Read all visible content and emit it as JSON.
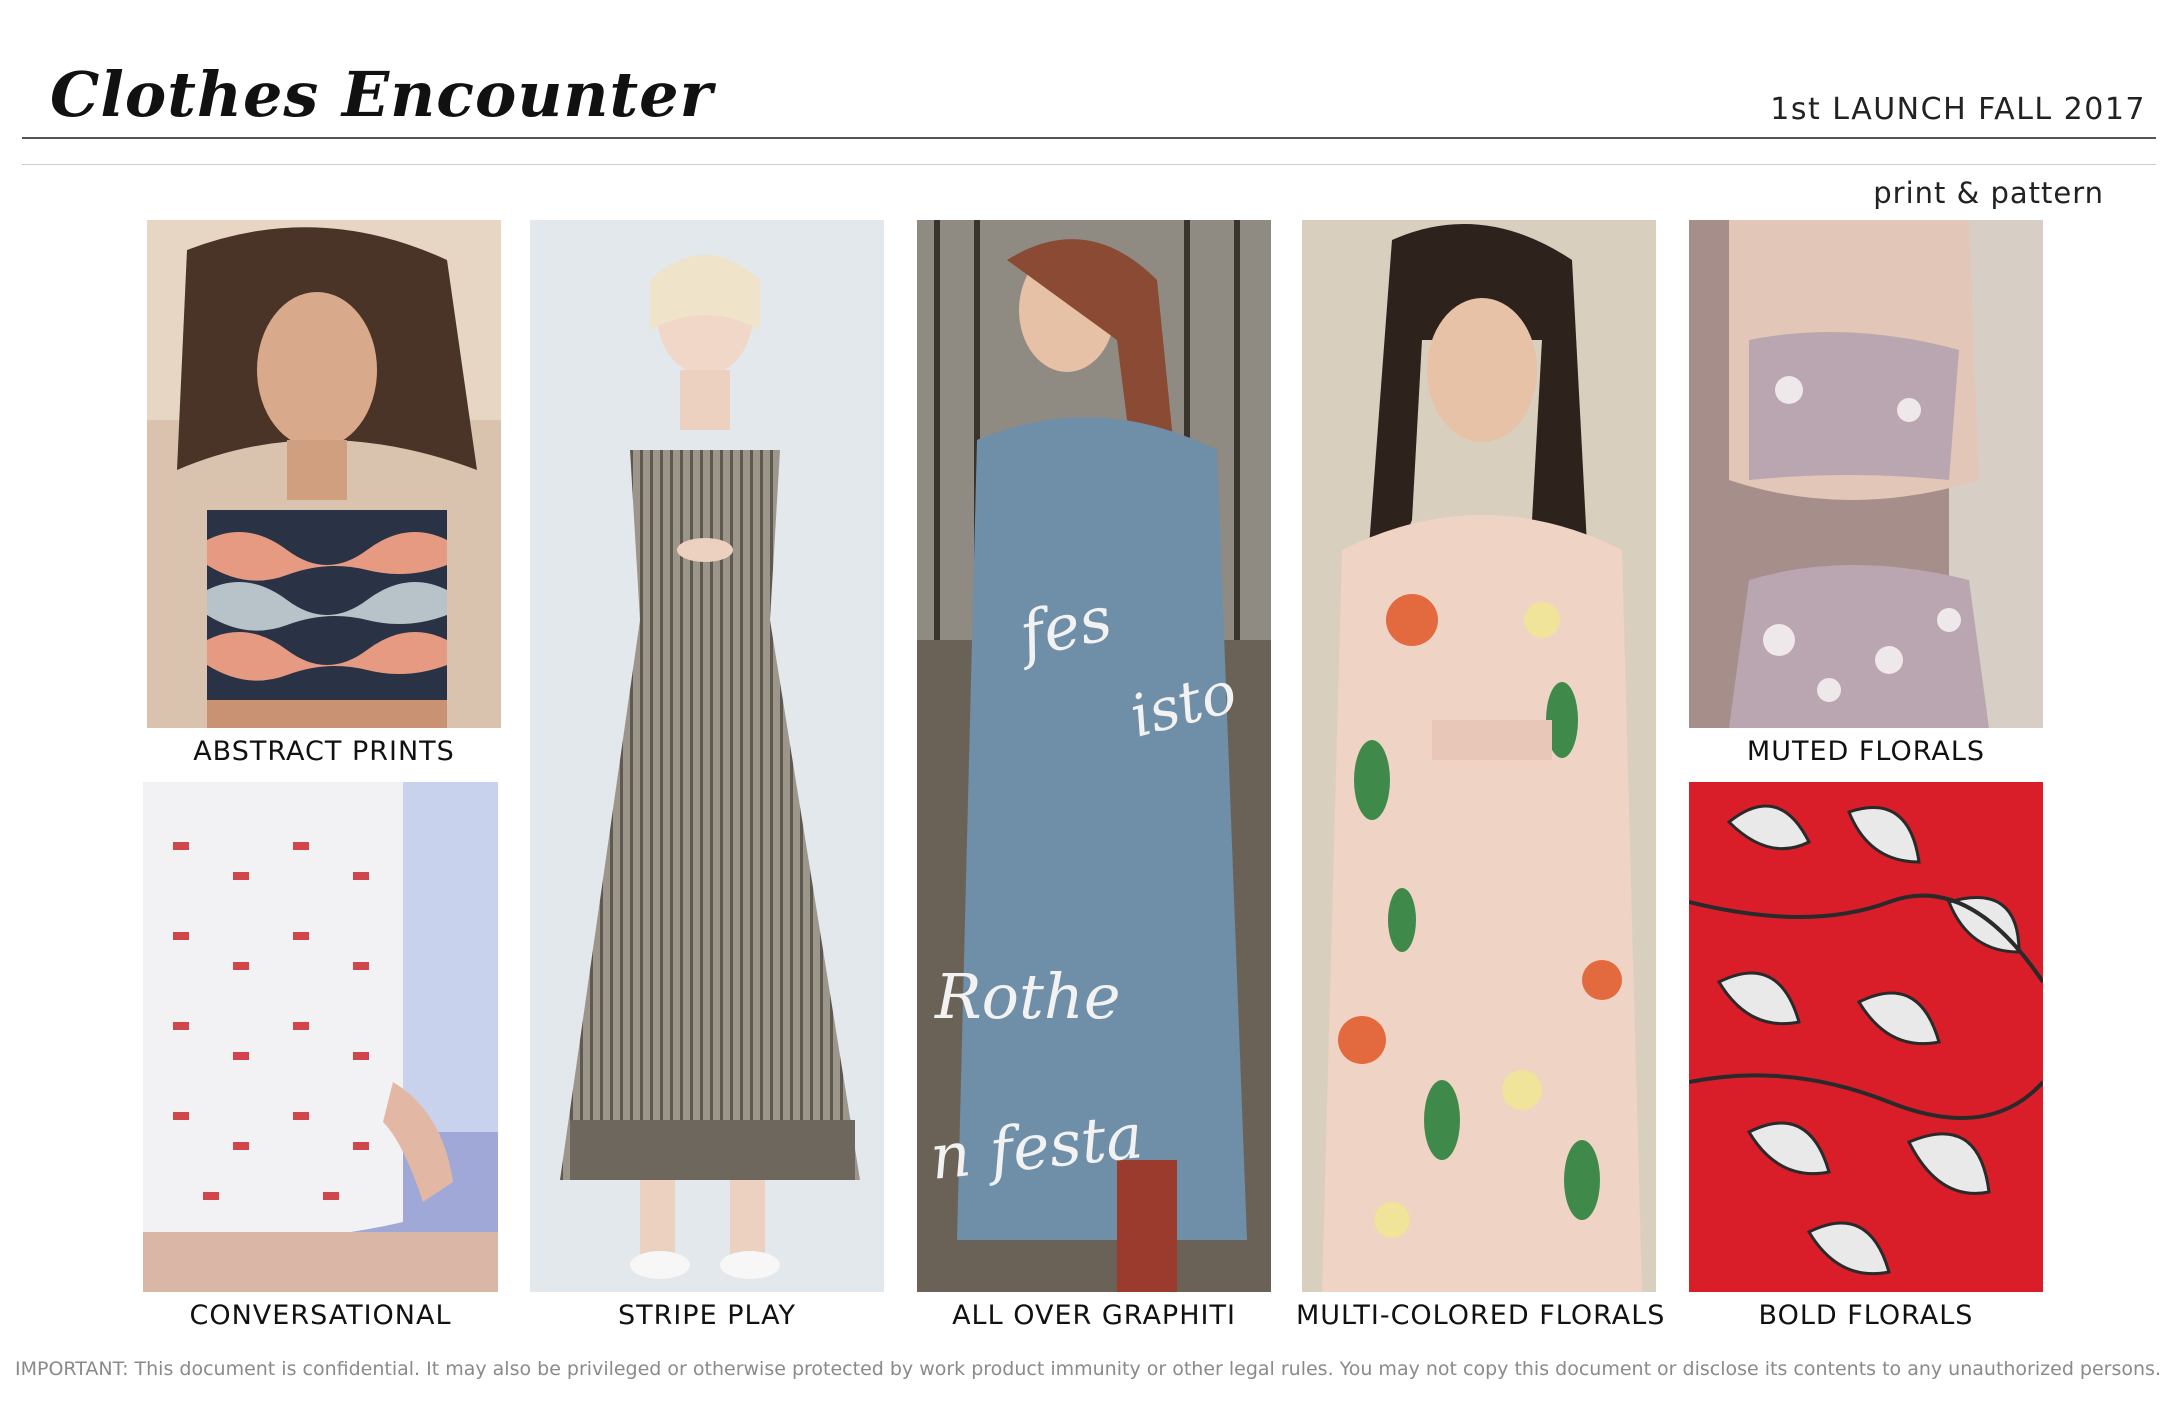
{
  "header": {
    "brand": "Clothes Encounter",
    "launch": "1st LAUNCH FALL 2017",
    "section": "print & pattern"
  },
  "panels": [
    {
      "caption": "ABSTRACT PRINTS"
    },
    {
      "caption": "CONVERSATIONAL"
    },
    {
      "caption": "STRIPE PLAY"
    },
    {
      "caption": "ALL OVER GRAPHITI"
    },
    {
      "caption": "MULTI-COLORED FLORALS"
    },
    {
      "caption": "MUTED FLORALS"
    },
    {
      "caption": "BOLD FLORALS"
    }
  ],
  "graffiti_text": [
    "fes",
    "isto",
    "Rothe",
    "n festa"
  ],
  "footer": {
    "disclaimer": "IMPORTANT: This document is confidential. It may also be privileged or otherwise protected by work product immunity or other legal rules. You may not copy this document or disclose its contents to any unauthorized persons."
  },
  "colors": {
    "abstract_navy": "#2a3345",
    "abstract_salmon": "#e79a82",
    "stripe_gray": "#8a8478",
    "graffiti_blue": "#6f8ea8",
    "floral_pink": "#efd3c4",
    "muted_lavender": "#b9a6b0",
    "bold_red": "#d91e2a"
  }
}
